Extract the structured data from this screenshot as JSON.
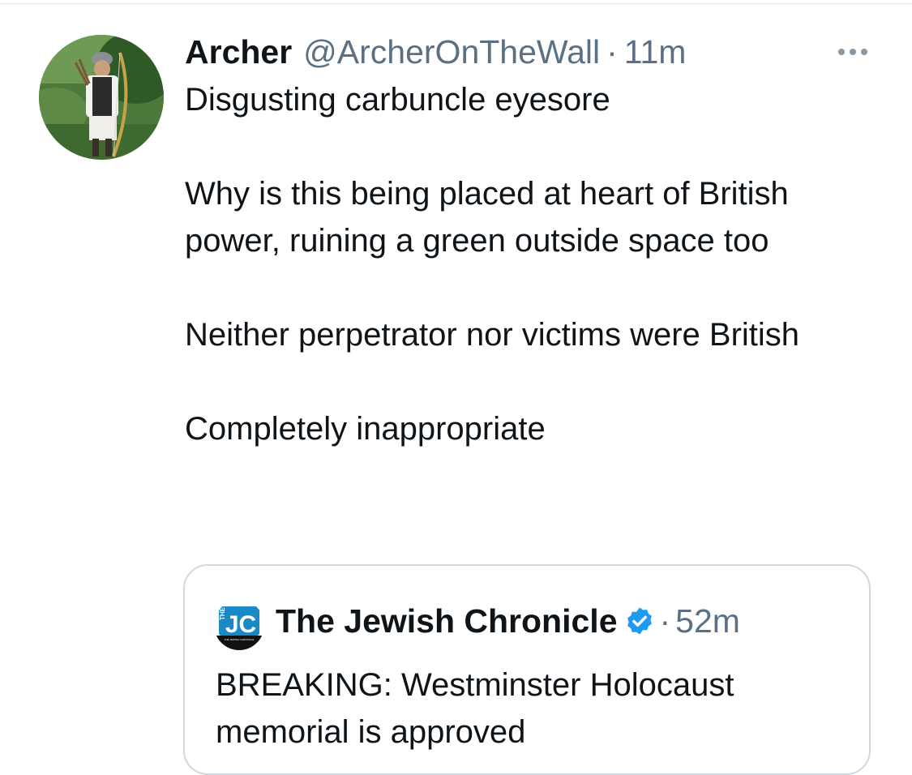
{
  "tweet": {
    "author_name": "Archer",
    "author_handle": "@ArcherOnTheWall",
    "separator": "·",
    "time": "11m",
    "text": "Disgusting carbuncle eyesore\n\nWhy is this being placed at heart of British power, ruining a green outside space too\n\nNeither perpetrator nor victims were British\n\nCompletely inappropriate",
    "more_icon": "more-horizontal-icon"
  },
  "quoted_tweet": {
    "author_name": "The Jewish Chronicle",
    "verified_icon": "verified-badge-icon",
    "separator": "·",
    "time": "52m",
    "text": "BREAKING: Westminster Holocaust memorial is approved",
    "avatar_logo": {
      "top_text": "THE",
      "monogram": "JC",
      "small_text": "THE JEWISH CHRONICLE"
    }
  },
  "colors": {
    "text_primary": "#0f1419",
    "text_secondary": "#5b7083",
    "border": "#cfd9de",
    "verified": "#1d9bf0",
    "jc_blue": "#1a8ac7"
  }
}
